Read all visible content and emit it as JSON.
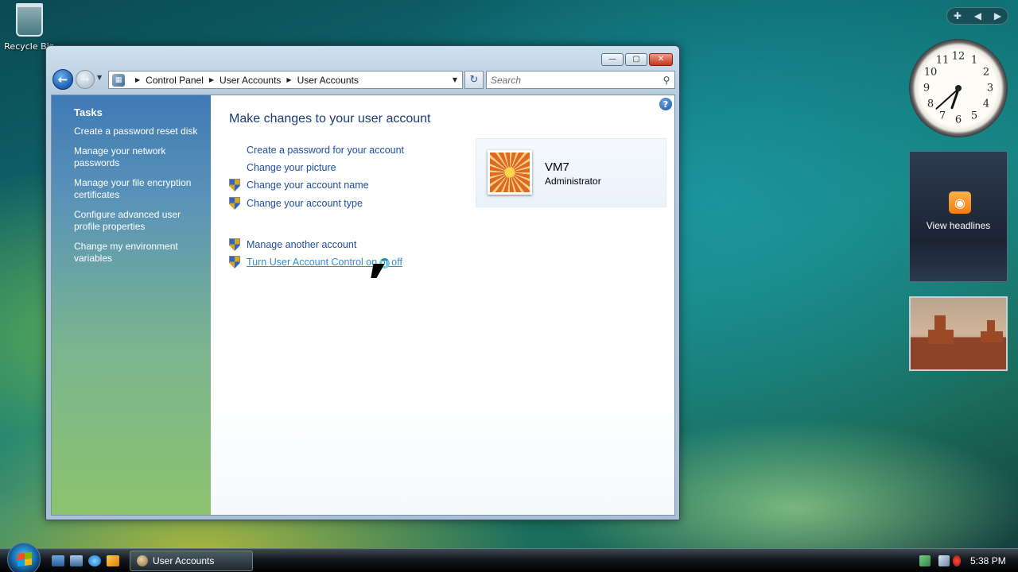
{
  "desktop": {
    "recycle_bin_label": "Recycle Bin"
  },
  "window": {
    "address": {
      "crumbs": [
        "Control Panel",
        "User Accounts",
        "User Accounts"
      ]
    },
    "search": {
      "placeholder": "Search"
    },
    "tasks": {
      "title": "Tasks",
      "items": [
        "Create a password reset disk",
        "Manage your network passwords",
        "Manage your file encryption certificates",
        "Configure advanced user profile properties",
        "Change my environment variables"
      ]
    },
    "main": {
      "title": "Make changes to your user account",
      "actions": [
        {
          "label": "Create a password for your account",
          "shield": false
        },
        {
          "label": "Change your picture",
          "shield": false
        },
        {
          "label": "Change your account name",
          "shield": true
        },
        {
          "label": "Change your account type",
          "shield": true
        },
        {
          "label": "Manage another account",
          "shield": true
        },
        {
          "label": "Turn User Account Control on or off",
          "shield": true,
          "hovered": true
        }
      ]
    },
    "user": {
      "name": "VM7",
      "role": "Administrator"
    }
  },
  "gadgets": {
    "clock": {
      "time_displayed": "5:38",
      "numerals": [
        "12",
        "1",
        "2",
        "3",
        "4",
        "5",
        "6",
        "7",
        "8",
        "9",
        "10",
        "11"
      ]
    },
    "feed": {
      "label": "View headlines"
    }
  },
  "taskbar": {
    "active_task": "User Accounts",
    "clock": "5:38 PM"
  },
  "colors": {
    "link": "#1e4ea1",
    "link_hover": "#3a8ad6",
    "title": "#1b3a7a"
  }
}
